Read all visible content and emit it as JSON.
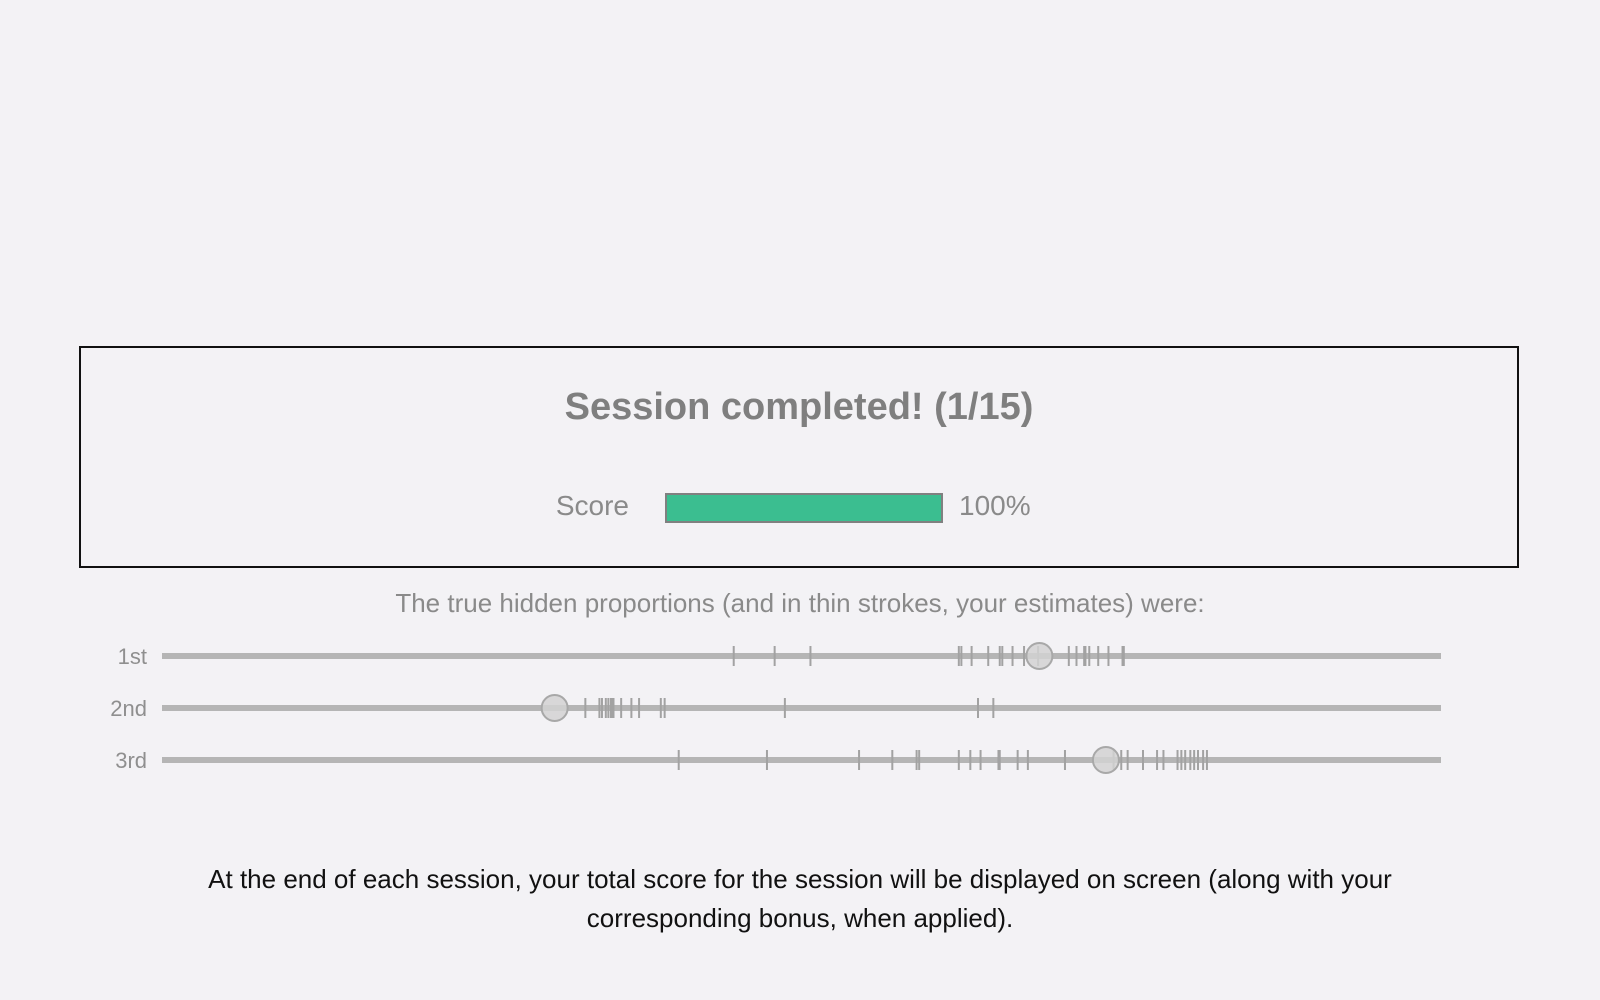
{
  "feedback": {
    "title": "Session completed! (1/15)",
    "score_label": "Score",
    "score_percent": 100,
    "score_text": "100%",
    "bar_color": "#3bbe90"
  },
  "estimates": {
    "caption": "The true hidden proportions (and in thin strokes, your estimates) were:",
    "rows": [
      {
        "label": "1st",
        "true_value": 0.686,
        "estimates": [
          0.447,
          0.479,
          0.507,
          0.623,
          0.625,
          0.633,
          0.646,
          0.655,
          0.657,
          0.665,
          0.674,
          0.685,
          0.709,
          0.715,
          0.721,
          0.722,
          0.725,
          0.732,
          0.74,
          0.751,
          0.752
        ]
      },
      {
        "label": "2nd",
        "true_value": 0.307,
        "estimates": [
          0.331,
          0.342,
          0.344,
          0.347,
          0.349,
          0.351,
          0.352,
          0.353,
          0.359,
          0.367,
          0.373,
          0.39,
          0.393,
          0.487,
          0.638,
          0.65
        ]
      },
      {
        "label": "3rd",
        "true_value": 0.738,
        "estimates": [
          0.404,
          0.473,
          0.545,
          0.571,
          0.59,
          0.592,
          0.623,
          0.632,
          0.64,
          0.654,
          0.655,
          0.669,
          0.677,
          0.706,
          0.744,
          0.75,
          0.755,
          0.767,
          0.778,
          0.783,
          0.794,
          0.797,
          0.8,
          0.804,
          0.807,
          0.81,
          0.814,
          0.817
        ]
      }
    ]
  },
  "instructions": {
    "text": "At the end of each session, your total score for the session will be displayed on screen (along with your corresponding bonus, when applied)."
  }
}
